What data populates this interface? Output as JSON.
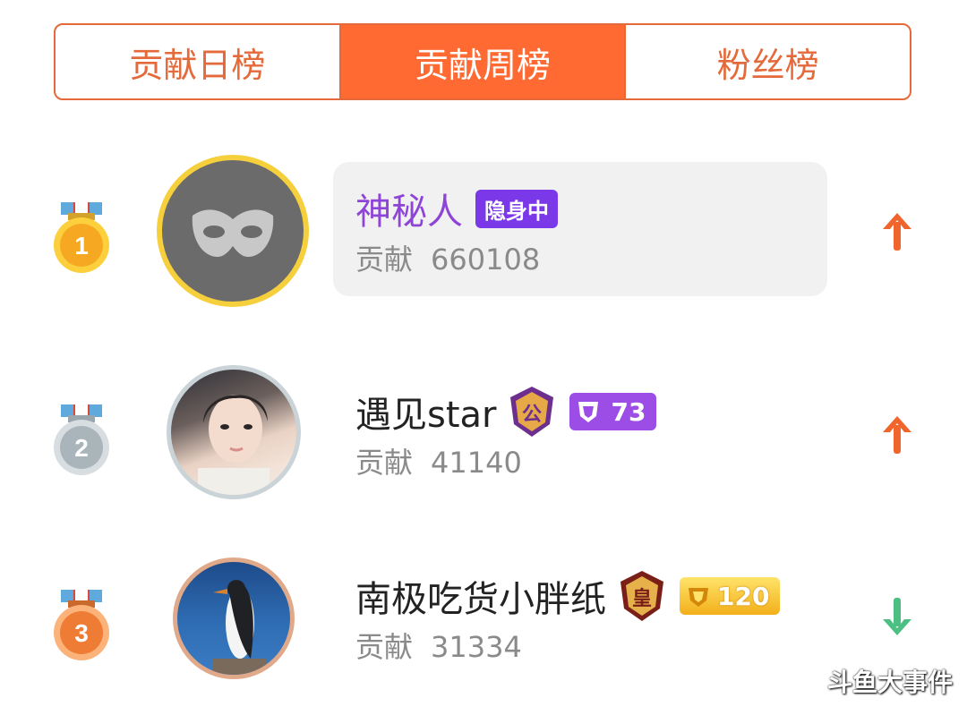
{
  "tabs": [
    {
      "label": "贡献日榜",
      "active": false
    },
    {
      "label": "贡献周榜",
      "active": true
    },
    {
      "label": "粉丝榜",
      "active": false
    }
  ],
  "ranking": [
    {
      "rank": "1",
      "name": "神秘人",
      "badge": "隐身中",
      "contribution_label": "贡献",
      "contribution": "660108",
      "trend": "up",
      "avatar": "mask-icon"
    },
    {
      "rank": "2",
      "name": "遇见star",
      "noble_char": "公",
      "level": "73",
      "contribution_label": "贡献",
      "contribution": "41140",
      "trend": "up",
      "avatar": "user-photo"
    },
    {
      "rank": "3",
      "name": "南极吃货小胖纸",
      "noble_char": "皇",
      "level": "120",
      "contribution_label": "贡献",
      "contribution": "31334",
      "trend": "down",
      "avatar": "penguin-photo"
    }
  ],
  "watermark": "斗鱼大事件",
  "colors": {
    "accent": "#ff6a33",
    "up": "#f0652b",
    "down": "#4cc082",
    "hidden_badge": "#7b38e8",
    "name_hidden": "#8e44d6"
  }
}
